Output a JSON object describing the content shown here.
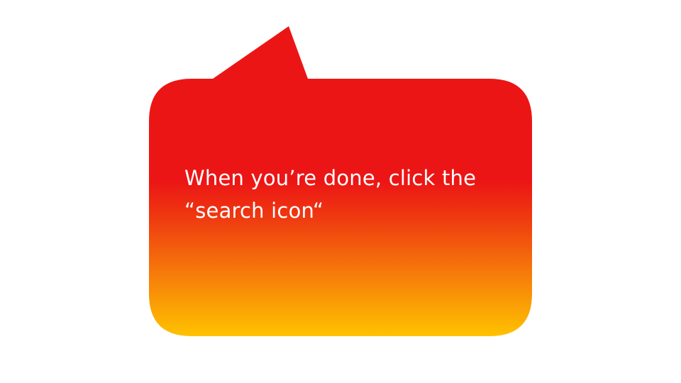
{
  "bubble": {
    "line1": "When you’re done, click the",
    "line2": "“search icon“",
    "colors": {
      "top": "#ec1515",
      "upper_mid": "#ec1515",
      "mid": "#ef3a10",
      "lower_mid": "#f67c0a",
      "bottom": "#ffc200",
      "text": "#ffffff",
      "background": "#ffffff"
    }
  }
}
